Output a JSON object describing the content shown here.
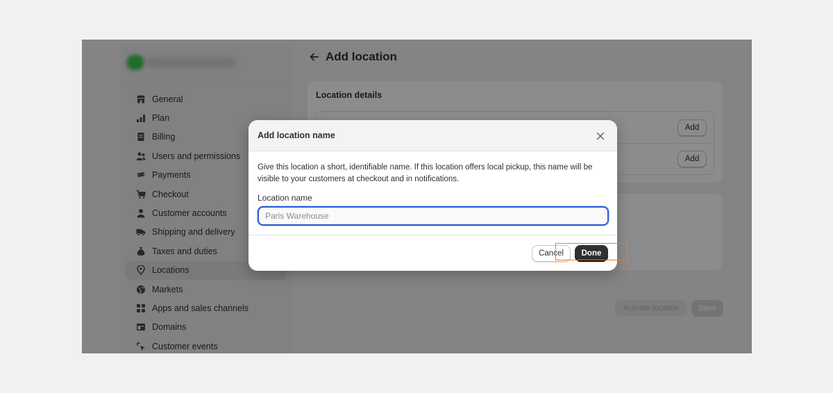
{
  "sidebar": {
    "items": [
      {
        "label": "General",
        "icon": "store-icon"
      },
      {
        "label": "Plan",
        "icon": "chart-icon"
      },
      {
        "label": "Billing",
        "icon": "receipt-icon"
      },
      {
        "label": "Users and permissions",
        "icon": "users-icon"
      },
      {
        "label": "Payments",
        "icon": "payments-icon"
      },
      {
        "label": "Checkout",
        "icon": "cart-icon"
      },
      {
        "label": "Customer accounts",
        "icon": "person-icon"
      },
      {
        "label": "Shipping and delivery",
        "icon": "truck-icon"
      },
      {
        "label": "Taxes and duties",
        "icon": "money-bag-icon"
      },
      {
        "label": "Locations",
        "icon": "location-pin-icon"
      },
      {
        "label": "Markets",
        "icon": "globe-icon"
      },
      {
        "label": "Apps and sales channels",
        "icon": "apps-icon"
      },
      {
        "label": "Domains",
        "icon": "domain-icon"
      },
      {
        "label": "Customer events",
        "icon": "cursor-sparkle-icon"
      }
    ],
    "active_item": "Locations"
  },
  "main": {
    "title": "Add location",
    "card_title": "Location details",
    "add_label_1": "Add",
    "add_label_2": "Add",
    "activate_label": "Activate location",
    "save_label": "Save"
  },
  "modal": {
    "title": "Add location name",
    "description": "Give this location a short, identifiable name. If this location offers local pickup, this name will be visible to your customers at checkout and in notifications.",
    "field_label": "Location name",
    "field_value": "",
    "field_placeholder": "Paris Warehouse",
    "cancel_label": "Cancel",
    "done_label": "Done"
  },
  "colors": {
    "accent_focus": "#2a5bd7",
    "primary_button": "#303030",
    "highlight": "#f07a2a"
  }
}
